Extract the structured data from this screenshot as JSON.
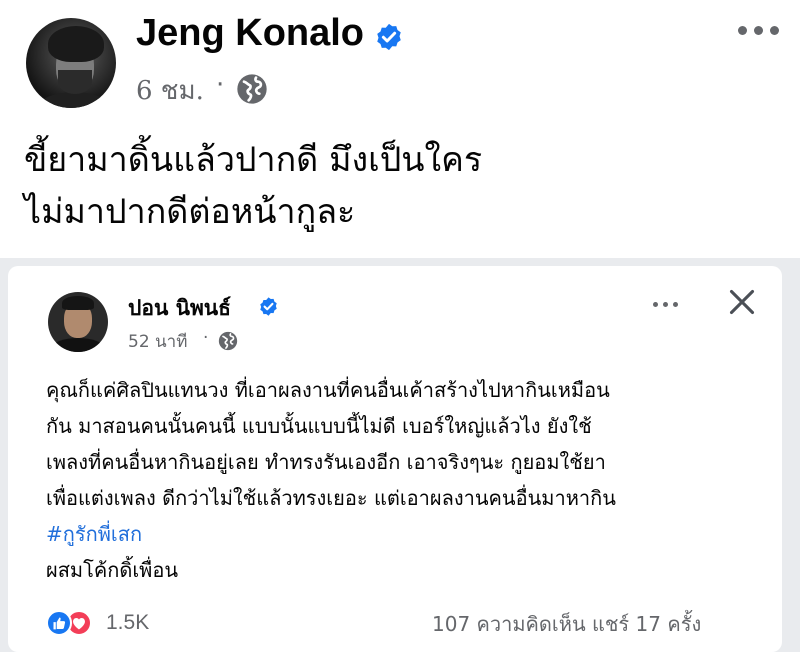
{
  "outer_post": {
    "author": "Jeng Konalo",
    "timestamp": "6 ชม.",
    "separator": "·",
    "privacy_icon": "globe-icon",
    "verified_icon": "verified-badge-icon",
    "text_lines": [
      "ขี้ยามาดิ้นแล้วปากดี   มึงเป็นใคร",
      "ไม่มาปากดีต่อหน้ากูละ"
    ]
  },
  "shared_post": {
    "author": "ปอน นิพนธ์",
    "timestamp": "52 นาที",
    "separator": "·",
    "privacy_icon": "globe-icon",
    "verified_icon": "verified-badge-icon",
    "text_lines": [
      "คุณก็แค่ศิลปินแทนวง ที่เอาผลงานที่คนอื่นเค้าสร้างไปหากินเหมือน",
      "กัน มาสอนคนนั้นคนนี้ แบบนั้นแบบนี้ไม่ดี เบอร์ใหญ่แล้วไง ยังใช้",
      "เพลงที่คนอื่นหากินอยู่เลย ทำทรงรันเองอีก เอาจริงๆนะ กูยอมใช้ยา",
      "เพื่อแต่งเพลง ดีกว่าไม่ใช้แล้วทรงเยอะ แต่เอาผลงานคนอื่นมาหากิน"
    ],
    "hashtag": "#กูรักพี่เสก",
    "last_line": "ผสมโค้กดิ้เพื่อน",
    "reaction_count": "1.5K",
    "stats": "107 ความคิดเห็น  แชร์ 17 ครั้ง"
  },
  "colors": {
    "primary_text": "#050505",
    "secondary_text": "#65676b",
    "facebook_blue": "#1877f2",
    "hashtag_blue": "#216fdb",
    "love_red": "#f33e58"
  }
}
